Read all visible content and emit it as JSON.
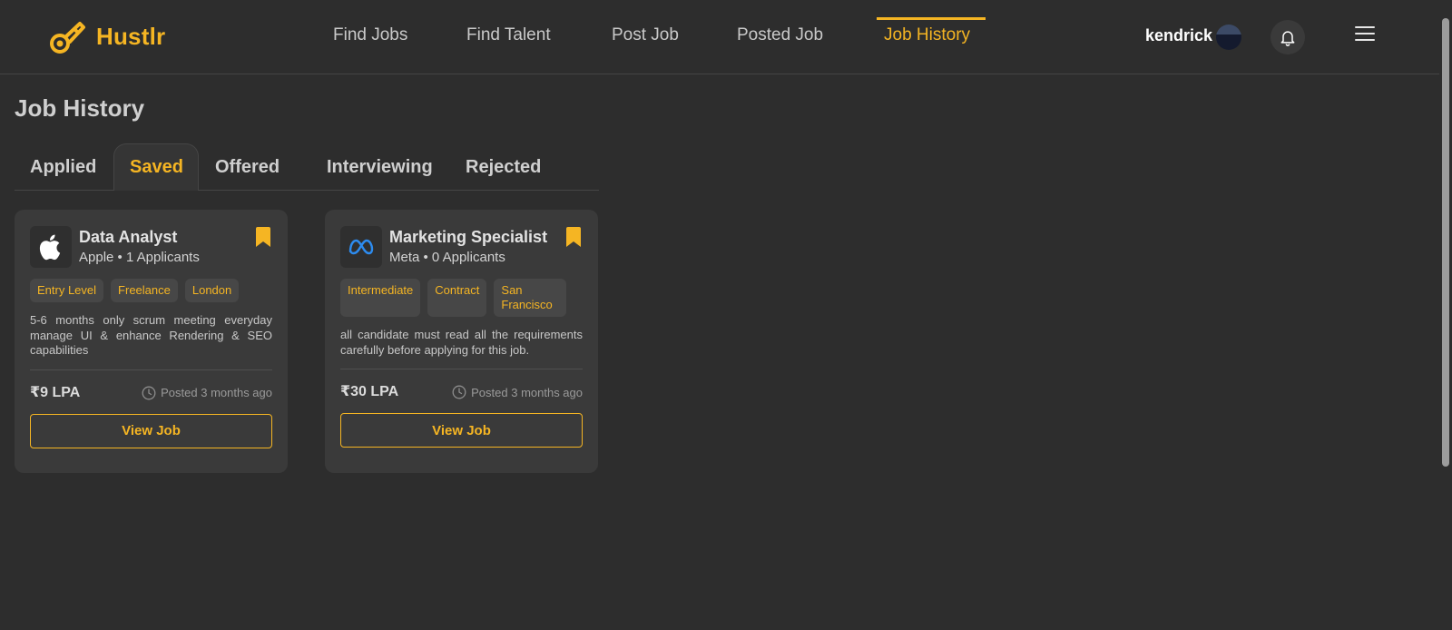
{
  "brand": {
    "name": "Hustlr"
  },
  "nav": {
    "items": [
      {
        "label": "Find Jobs"
      },
      {
        "label": "Find Talent"
      },
      {
        "label": "Post Job"
      },
      {
        "label": "Posted Job"
      },
      {
        "label": "Job History"
      }
    ],
    "active": "Job History"
  },
  "user": {
    "name": "kendrick"
  },
  "icons": {
    "bell": "bell-icon",
    "menu": "hamburger-menu-icon",
    "clock": "clock-icon",
    "bookmark": "bookmark-icon"
  },
  "colors": {
    "accent": "#f5b523",
    "background": "#2d2d2d",
    "card": "#3a3a3a"
  },
  "page": {
    "title": "Job History"
  },
  "tabs": {
    "items": [
      {
        "label": "Applied"
      },
      {
        "label": "Saved"
      },
      {
        "label": "Offered"
      },
      {
        "label": "Interviewing"
      },
      {
        "label": "Rejected"
      }
    ],
    "active": "Saved"
  },
  "jobs": [
    {
      "title": "Data Analyst",
      "subtitle": "Apple • 1 Applicants",
      "company_icon": "apple-logo-icon",
      "tags": [
        "Entry Level",
        "Freelance",
        "London"
      ],
      "description": "5-6 months only scrum meeting everyday manage UI & enhance Rendering & SEO capabilities",
      "salary": "₹9 LPA",
      "posted": "Posted 3 months ago",
      "button": "View Job"
    },
    {
      "title": "Marketing Specialist",
      "subtitle": "Meta • 0 Applicants",
      "company_icon": "meta-logo-icon",
      "tags": [
        "Intermediate",
        "Contract",
        "San Francisco"
      ],
      "description": "all candidate must read all the requirements carefully before applying for this job.",
      "salary": "₹30 LPA",
      "posted": "Posted 3 months ago",
      "button": "View Job"
    }
  ]
}
